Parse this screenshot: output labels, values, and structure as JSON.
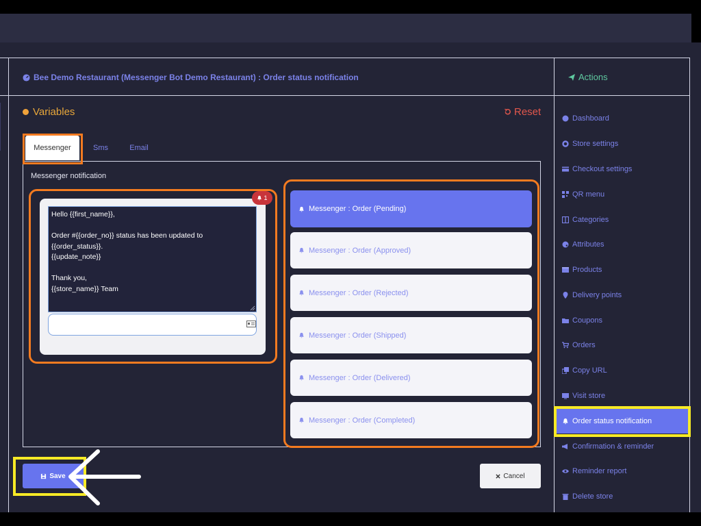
{
  "header": {
    "title": "Bee Demo Restaurant (Messenger Bot Demo Restaurant) : Order status notification"
  },
  "actions": {
    "title": "Actions"
  },
  "variables": {
    "title": "Variables",
    "reset_label": "Reset"
  },
  "tabs": [
    {
      "label": "Messenger",
      "active": true
    },
    {
      "label": "Sms",
      "active": false
    },
    {
      "label": "Email",
      "active": false
    }
  ],
  "panel": {
    "label": "Messenger notification"
  },
  "editor": {
    "badge": "1",
    "message": "Hello {{first_name}},\n\nOrder #{{order_no}} status has been updated to\n{{order_status}}.\n{{update_note}}\n\nThank you,\n{{store_name}} Team",
    "input_value": ""
  },
  "templates": [
    {
      "label": "Messenger : Order (Pending)",
      "active": true
    },
    {
      "label": "Messenger : Order (Approved)",
      "active": false
    },
    {
      "label": "Messenger : Order (Rejected)",
      "active": false
    },
    {
      "label": "Messenger : Order (Shipped)",
      "active": false
    },
    {
      "label": "Messenger : Order (Delivered)",
      "active": false
    },
    {
      "label": "Messenger : Order (Completed)",
      "active": false
    }
  ],
  "buttons": {
    "save_label": "Save",
    "cancel_label": "Cancel"
  },
  "sidebar": {
    "items": [
      {
        "label": "Dashboard",
        "icon": "dashboard-icon"
      },
      {
        "label": "Store settings",
        "icon": "gear-icon"
      },
      {
        "label": "Checkout settings",
        "icon": "credit-card-icon"
      },
      {
        "label": "QR menu",
        "icon": "qrcode-icon"
      },
      {
        "label": "Categories",
        "icon": "columns-icon"
      },
      {
        "label": "Attributes",
        "icon": "palette-icon"
      },
      {
        "label": "Products",
        "icon": "box-icon"
      },
      {
        "label": "Delivery points",
        "icon": "map-marker-icon"
      },
      {
        "label": "Coupons",
        "icon": "folder-icon"
      },
      {
        "label": "Orders",
        "icon": "cart-icon"
      },
      {
        "label": "Copy URL",
        "icon": "copy-icon"
      },
      {
        "label": "Visit store",
        "icon": "tv-icon"
      },
      {
        "label": "Order status notification",
        "icon": "bell-icon",
        "active": true
      },
      {
        "label": "Confirmation & reminder",
        "icon": "megaphone-icon"
      },
      {
        "label": "Reminder report",
        "icon": "eye-icon"
      },
      {
        "label": "Delete store",
        "icon": "trash-icon"
      }
    ]
  },
  "colors": {
    "accent": "#6774ee",
    "highlight_orange": "#f47b20",
    "highlight_yellow": "#f7ea26",
    "reset": "#e2574c",
    "variables": "#e8a73a",
    "actions": "#5fc9a0"
  }
}
